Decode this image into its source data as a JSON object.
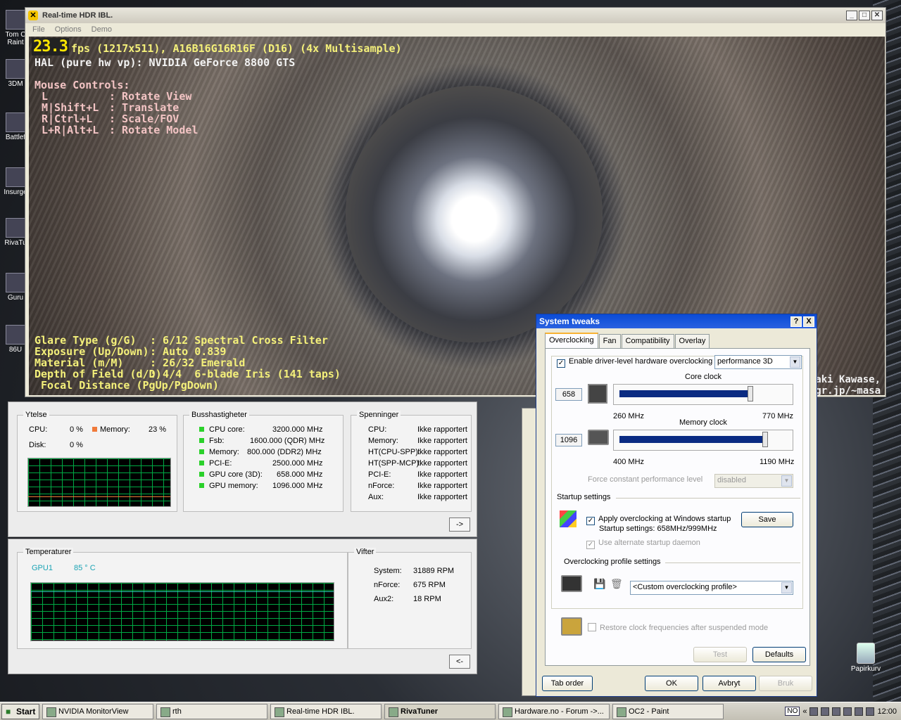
{
  "desktop": {
    "icons": [
      {
        "label": "Tom C Raint"
      },
      {
        "label": "3DM"
      },
      {
        "label": "Battlef"
      },
      {
        "label": "Insurge"
      },
      {
        "label": "RivaTu"
      },
      {
        "label": "Guru"
      },
      {
        "label": "86U"
      }
    ],
    "recycle_bin": "Papirkurv"
  },
  "hdr_window": {
    "title": "Real-time HDR IBL.",
    "menu": [
      "File",
      "Options",
      "Demo"
    ],
    "fps_value": "23.3",
    "hud_line1": "fps (1217x511), A16B16G16R16F (D16) (4x Multisample)",
    "hud_line2": "HAL (pure hw vp): NVIDIA GeForce 8800 GTS",
    "mouse_controls_title": "Mouse Controls:",
    "mouse_controls": [
      {
        "key": "L",
        "action": ": Rotate View"
      },
      {
        "key": "M|Shift+L",
        "action": ": Translate"
      },
      {
        "key": "R|Ctrl+L",
        "action": ": Scale/FOV"
      },
      {
        "key": "L+R|Alt+L",
        "action": ": Rotate Model"
      }
    ],
    "settings": [
      {
        "label": "Glare Type (g/G)",
        "value": ": 6/12 Spectral Cross Filter"
      },
      {
        "label": "Exposure (Up/Down)",
        "value": ": Auto 0.839"
      },
      {
        "label": "Material (m/M)",
        "value": ": 26/32 Emerald"
      },
      {
        "label": "Depth of Field (d/D)",
        "value": ": 4/4  6-blade Iris (141 taps)"
      },
      {
        "label": " Focal Distance (PgUp/PgDown)",
        "value": ""
      }
    ],
    "credit_line1": "aki Kawase,",
    "credit_line2": "gr.jp/~masa"
  },
  "monitor_top": {
    "ytelse": {
      "title": "Ytelse",
      "cpu_label": "CPU:",
      "cpu_value": "0 %",
      "memory_label": "Memory:",
      "memory_value": "23 %",
      "disk_label": "Disk:",
      "disk_value": "0 %"
    },
    "buss": {
      "title": "Busshastigheter",
      "rows": [
        {
          "label": "CPU core:",
          "value": "3200.000 MHz"
        },
        {
          "label": "Fsb:",
          "value": "1600.000 (QDR) MHz"
        },
        {
          "label": "Memory:",
          "value": "800.000  (DDR2) MHz"
        },
        {
          "label": "PCI-E:",
          "value": "2500.000 MHz"
        },
        {
          "label": "GPU core (3D):",
          "value": "658.000 MHz"
        },
        {
          "label": "GPU memory:",
          "value": "1096.000 MHz"
        }
      ]
    },
    "spenninger": {
      "title": "Spenninger",
      "rows": [
        {
          "label": "CPU:",
          "value": "Ikke rapportert"
        },
        {
          "label": "Memory:",
          "value": "Ikke rapportert"
        },
        {
          "label": "HT(CPU-SPP):",
          "value": "Ikke rapportert"
        },
        {
          "label": "HT(SPP-MCP):",
          "value": "Ikke rapportert"
        },
        {
          "label": "PCI-E:",
          "value": "Ikke rapportert"
        },
        {
          "label": "nForce:",
          "value": "Ikke rapportert"
        },
        {
          "label": "Aux:",
          "value": "Ikke rapportert"
        }
      ]
    },
    "next_button": "->"
  },
  "monitor_bottom": {
    "temperatur": {
      "title": "Temperaturer",
      "sensor_label": "GPU1",
      "sensor_value": "85 ° C"
    },
    "vifter": {
      "title": "Vifter",
      "rows": [
        {
          "label": "System:",
          "value": "31889 RPM"
        },
        {
          "label": "nForce:",
          "value": "675 RPM"
        },
        {
          "label": "Aux2:",
          "value": "18 RPM"
        }
      ]
    },
    "prev_button": "<-"
  },
  "system_tweaks": {
    "title": "System tweaks",
    "help_btn": "?",
    "close_btn": "X",
    "tabs": [
      "Overclocking",
      "Fan",
      "Compatibility",
      "Overlay"
    ],
    "enable_label": "Enable driver-level hardware overclocking",
    "mode_value": "performance 3D",
    "core": {
      "title": "Core clock",
      "value": "658",
      "min": "260 MHz",
      "max": "770 MHz",
      "fill_fraction": 0.78
    },
    "memory": {
      "title": "Memory clock",
      "value": "1096",
      "min": "400 MHz",
      "max": "1190 MHz",
      "fill_fraction": 0.87
    },
    "force_label": "Force constant performance level",
    "force_value": "disabled",
    "startup_title": "Startup settings",
    "apply_label": "Apply overclocking at Windows startup",
    "startup_info": "Startup settings: 658MHz/999MHz",
    "save_btn": "Save",
    "alt_daemon_label": "Use alternate startup daemon",
    "profile_title": "Overclocking profile settings",
    "profile_value": "<Custom overclocking profile>",
    "restore_label": "Restore clock frequencies after suspended mode",
    "test_btn": "Test",
    "defaults_btn": "Defaults",
    "tab_order_btn": "Tab order",
    "ok_btn": "OK",
    "cancel_btn": "Avbryt",
    "apply_btn": "Bruk"
  },
  "taskbar": {
    "start": "Start",
    "items": [
      {
        "label": "NVIDIA MonitorView",
        "active": false
      },
      {
        "label": "rth",
        "active": false
      },
      {
        "label": "Real-time HDR IBL.",
        "active": false
      },
      {
        "label": "RivaTuner",
        "active": true
      },
      {
        "label": "Hardware.no - Forum ->...",
        "active": false
      },
      {
        "label": "OC2 - Paint",
        "active": false
      }
    ],
    "lang": "NO",
    "clock": "12:00"
  }
}
